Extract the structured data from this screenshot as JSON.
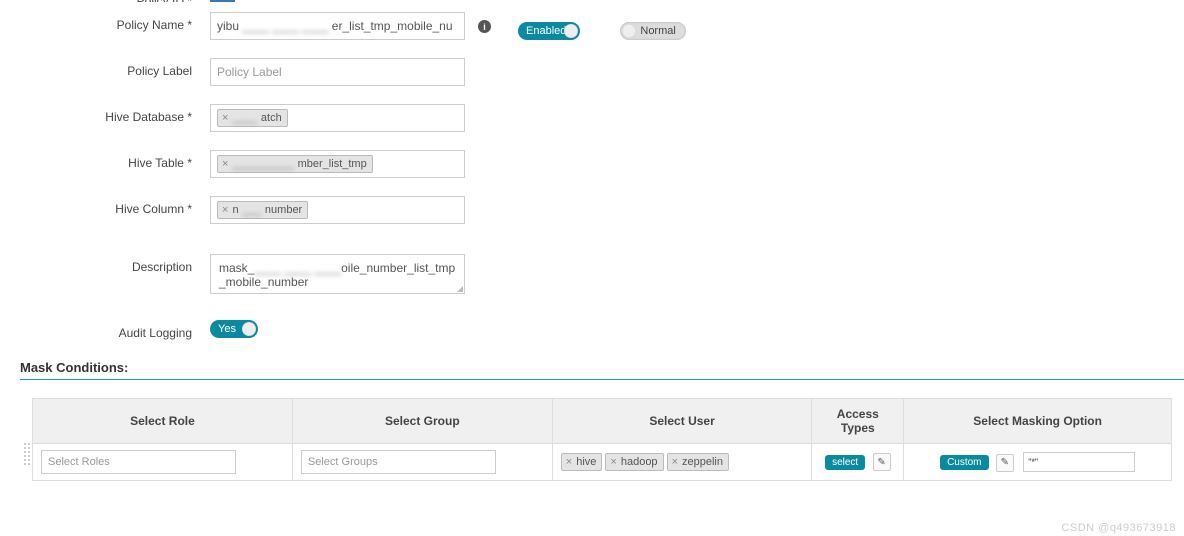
{
  "policy_id": {
    "label": "Policy ID *",
    "badge": ""
  },
  "policy_name": {
    "label": "Policy Name *",
    "value_prefix": "yibu",
    "value_blur": "____ ____ ____",
    "value_suffix": "er_list_tmp_mobile_nu"
  },
  "policy_label": {
    "label": "Policy Label",
    "placeholder": "Policy Label"
  },
  "hive_database": {
    "label": "Hive Database *",
    "tag_blur": "____",
    "tag_suffix": "atch"
  },
  "hive_table": {
    "label": "Hive Table *",
    "tag_blur": "__________",
    "tag_suffix": "mber_list_tmp"
  },
  "hive_column": {
    "label": "Hive Column *",
    "tag_prefix": "n",
    "tag_blur": "___",
    "tag_suffix": "number"
  },
  "description": {
    "label": "Description",
    "line1_prefix": "mask_",
    "line1_blur": "____ ____ ____",
    "line1_suffix": "oile_number_list_tmp",
    "line2": "_mobile_number"
  },
  "audit_logging": {
    "label": "Audit Logging",
    "toggle": "Yes"
  },
  "toggles": {
    "enabled": "Enabled",
    "normal": "Normal"
  },
  "section": {
    "title": "Mask Conditions:"
  },
  "table": {
    "headers": {
      "role": "Select Role",
      "group": "Select Group",
      "user": "Select User",
      "access": "Access Types",
      "mask": "Select Masking Option"
    },
    "row": {
      "role_placeholder": "Select Roles",
      "group_placeholder": "Select Groups",
      "users": [
        "hive",
        "hadoop",
        "zeppelin"
      ],
      "access_label": "select",
      "mask_label": "Custom",
      "mask_value": "\"*\""
    }
  },
  "watermark": "CSDN @q493673918"
}
